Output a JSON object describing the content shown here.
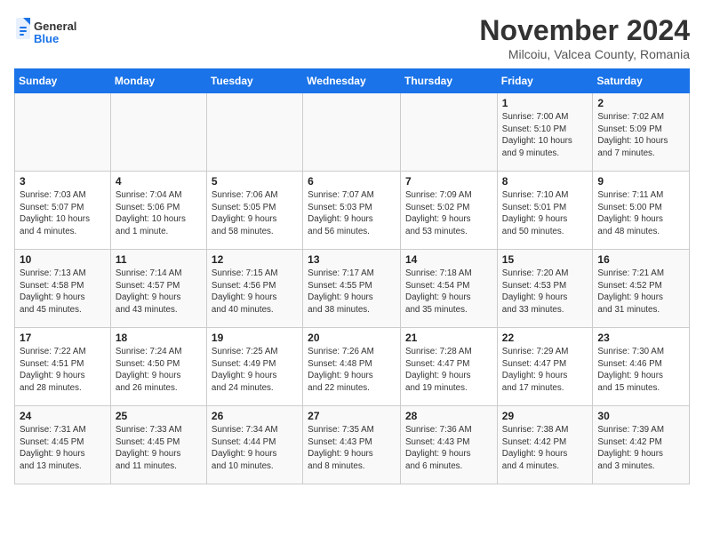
{
  "header": {
    "logo": {
      "general": "General",
      "blue": "Blue"
    },
    "title": "November 2024",
    "subtitle": "Milcoiu, Valcea County, Romania"
  },
  "weekdays": [
    "Sunday",
    "Monday",
    "Tuesday",
    "Wednesday",
    "Thursday",
    "Friday",
    "Saturday"
  ],
  "weeks": [
    [
      {
        "day": "",
        "info": ""
      },
      {
        "day": "",
        "info": ""
      },
      {
        "day": "",
        "info": ""
      },
      {
        "day": "",
        "info": ""
      },
      {
        "day": "",
        "info": ""
      },
      {
        "day": "1",
        "info": "Sunrise: 7:00 AM\nSunset: 5:10 PM\nDaylight: 10 hours\nand 9 minutes."
      },
      {
        "day": "2",
        "info": "Sunrise: 7:02 AM\nSunset: 5:09 PM\nDaylight: 10 hours\nand 7 minutes."
      }
    ],
    [
      {
        "day": "3",
        "info": "Sunrise: 7:03 AM\nSunset: 5:07 PM\nDaylight: 10 hours\nand 4 minutes."
      },
      {
        "day": "4",
        "info": "Sunrise: 7:04 AM\nSunset: 5:06 PM\nDaylight: 10 hours\nand 1 minute."
      },
      {
        "day": "5",
        "info": "Sunrise: 7:06 AM\nSunset: 5:05 PM\nDaylight: 9 hours\nand 58 minutes."
      },
      {
        "day": "6",
        "info": "Sunrise: 7:07 AM\nSunset: 5:03 PM\nDaylight: 9 hours\nand 56 minutes."
      },
      {
        "day": "7",
        "info": "Sunrise: 7:09 AM\nSunset: 5:02 PM\nDaylight: 9 hours\nand 53 minutes."
      },
      {
        "day": "8",
        "info": "Sunrise: 7:10 AM\nSunset: 5:01 PM\nDaylight: 9 hours\nand 50 minutes."
      },
      {
        "day": "9",
        "info": "Sunrise: 7:11 AM\nSunset: 5:00 PM\nDaylight: 9 hours\nand 48 minutes."
      }
    ],
    [
      {
        "day": "10",
        "info": "Sunrise: 7:13 AM\nSunset: 4:58 PM\nDaylight: 9 hours\nand 45 minutes."
      },
      {
        "day": "11",
        "info": "Sunrise: 7:14 AM\nSunset: 4:57 PM\nDaylight: 9 hours\nand 43 minutes."
      },
      {
        "day": "12",
        "info": "Sunrise: 7:15 AM\nSunset: 4:56 PM\nDaylight: 9 hours\nand 40 minutes."
      },
      {
        "day": "13",
        "info": "Sunrise: 7:17 AM\nSunset: 4:55 PM\nDaylight: 9 hours\nand 38 minutes."
      },
      {
        "day": "14",
        "info": "Sunrise: 7:18 AM\nSunset: 4:54 PM\nDaylight: 9 hours\nand 35 minutes."
      },
      {
        "day": "15",
        "info": "Sunrise: 7:20 AM\nSunset: 4:53 PM\nDaylight: 9 hours\nand 33 minutes."
      },
      {
        "day": "16",
        "info": "Sunrise: 7:21 AM\nSunset: 4:52 PM\nDaylight: 9 hours\nand 31 minutes."
      }
    ],
    [
      {
        "day": "17",
        "info": "Sunrise: 7:22 AM\nSunset: 4:51 PM\nDaylight: 9 hours\nand 28 minutes."
      },
      {
        "day": "18",
        "info": "Sunrise: 7:24 AM\nSunset: 4:50 PM\nDaylight: 9 hours\nand 26 minutes."
      },
      {
        "day": "19",
        "info": "Sunrise: 7:25 AM\nSunset: 4:49 PM\nDaylight: 9 hours\nand 24 minutes."
      },
      {
        "day": "20",
        "info": "Sunrise: 7:26 AM\nSunset: 4:48 PM\nDaylight: 9 hours\nand 22 minutes."
      },
      {
        "day": "21",
        "info": "Sunrise: 7:28 AM\nSunset: 4:47 PM\nDaylight: 9 hours\nand 19 minutes."
      },
      {
        "day": "22",
        "info": "Sunrise: 7:29 AM\nSunset: 4:47 PM\nDaylight: 9 hours\nand 17 minutes."
      },
      {
        "day": "23",
        "info": "Sunrise: 7:30 AM\nSunset: 4:46 PM\nDaylight: 9 hours\nand 15 minutes."
      }
    ],
    [
      {
        "day": "24",
        "info": "Sunrise: 7:31 AM\nSunset: 4:45 PM\nDaylight: 9 hours\nand 13 minutes."
      },
      {
        "day": "25",
        "info": "Sunrise: 7:33 AM\nSunset: 4:45 PM\nDaylight: 9 hours\nand 11 minutes."
      },
      {
        "day": "26",
        "info": "Sunrise: 7:34 AM\nSunset: 4:44 PM\nDaylight: 9 hours\nand 10 minutes."
      },
      {
        "day": "27",
        "info": "Sunrise: 7:35 AM\nSunset: 4:43 PM\nDaylight: 9 hours\nand 8 minutes."
      },
      {
        "day": "28",
        "info": "Sunrise: 7:36 AM\nSunset: 4:43 PM\nDaylight: 9 hours\nand 6 minutes."
      },
      {
        "day": "29",
        "info": "Sunrise: 7:38 AM\nSunset: 4:42 PM\nDaylight: 9 hours\nand 4 minutes."
      },
      {
        "day": "30",
        "info": "Sunrise: 7:39 AM\nSunset: 4:42 PM\nDaylight: 9 hours\nand 3 minutes."
      }
    ]
  ],
  "colors": {
    "header_bg": "#1a73e8",
    "accent": "#1a73e8"
  }
}
